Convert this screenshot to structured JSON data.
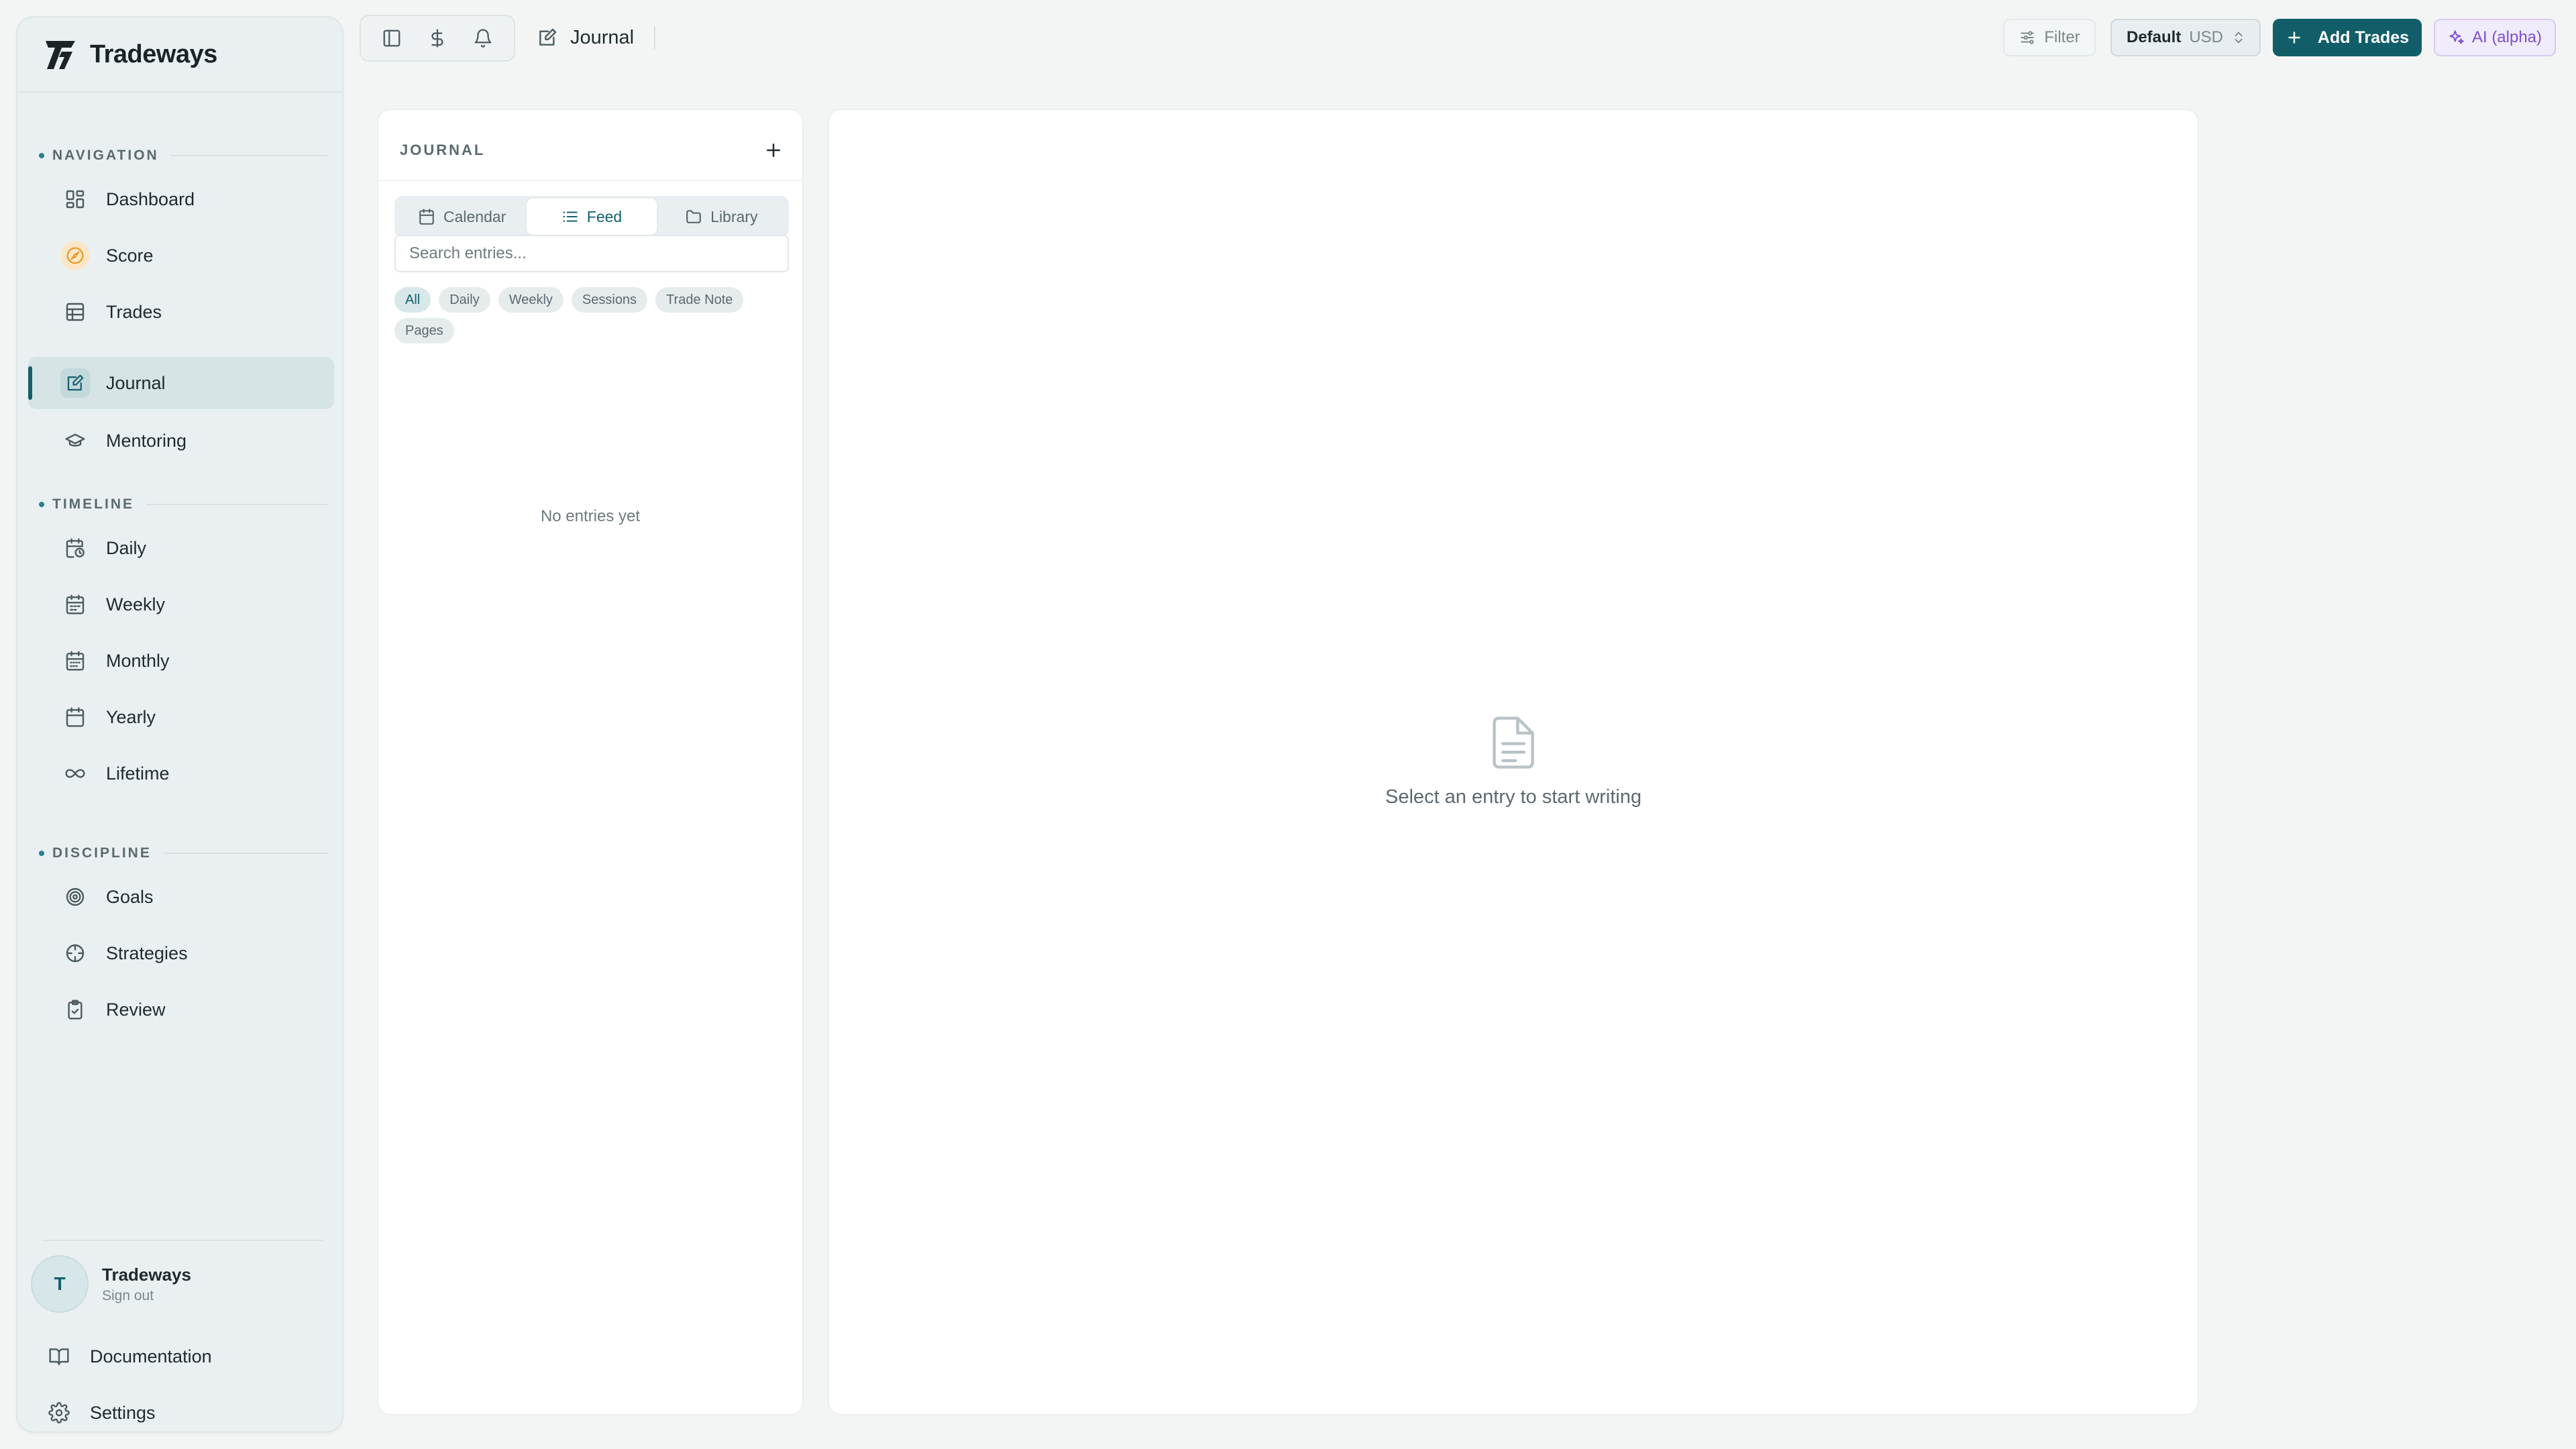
{
  "app": {
    "name": "Tradeways"
  },
  "sidebar": {
    "sections": [
      {
        "label": "NAVIGATION"
      },
      {
        "label": "TIMELINE"
      },
      {
        "label": "DISCIPLINE"
      }
    ],
    "navigation": [
      {
        "label": "Dashboard",
        "icon": "dashboard-icon"
      },
      {
        "label": "Score",
        "icon": "score-icon"
      },
      {
        "label": "Trades",
        "icon": "table-icon"
      },
      {
        "label": "Journal",
        "icon": "journal-icon",
        "active": true
      },
      {
        "label": "Mentoring",
        "icon": "graduation-cap-icon"
      }
    ],
    "timeline": [
      {
        "label": "Daily",
        "icon": "calendar-clock-icon"
      },
      {
        "label": "Weekly",
        "icon": "calendar-week-icon"
      },
      {
        "label": "Monthly",
        "icon": "calendar-month-icon"
      },
      {
        "label": "Yearly",
        "icon": "calendar-icon"
      },
      {
        "label": "Lifetime",
        "icon": "infinity-icon"
      }
    ],
    "discipline": [
      {
        "label": "Goals",
        "icon": "target-icon"
      },
      {
        "label": "Strategies",
        "icon": "crosshair-icon"
      },
      {
        "label": "Review",
        "icon": "clipboard-check-icon"
      }
    ],
    "user": {
      "initial": "T",
      "name": "Tradeways",
      "action": "Sign out"
    },
    "bottom": [
      {
        "label": "Documentation",
        "icon": "book-icon"
      },
      {
        "label": "Settings",
        "icon": "gear-icon"
      }
    ]
  },
  "topbar": {
    "breadcrumb": "Journal",
    "filter_label": "Filter",
    "account": {
      "name": "Default",
      "currency": "USD"
    },
    "add_trades_label": "Add Trades",
    "ai_label": "AI (alpha)"
  },
  "journal": {
    "title": "JOURNAL",
    "views": [
      {
        "label": "Calendar",
        "icon": "calendar-icon"
      },
      {
        "label": "Feed",
        "icon": "list-icon",
        "active": true
      },
      {
        "label": "Library",
        "icon": "folder-icon"
      }
    ],
    "search_placeholder": "Search entries...",
    "filters": [
      "All",
      "Daily",
      "Weekly",
      "Sessions",
      "Trade Note",
      "Pages"
    ],
    "active_filter": "All",
    "empty_text": "No entries yet"
  },
  "editor": {
    "empty_text": "Select an entry to start writing"
  },
  "colors": {
    "accent": "#115e69",
    "ai": "#7c4fd0",
    "background": "#f3f5f5"
  }
}
